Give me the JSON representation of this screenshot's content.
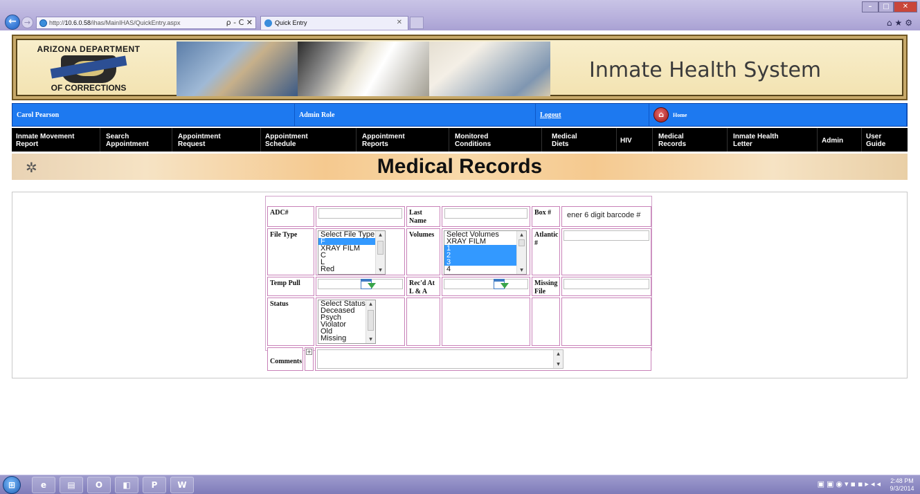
{
  "browser": {
    "address_prefix": "http://",
    "address_host": "10.6.0.58",
    "address_path": "/ihas/MainIHAS/QuickEntry.aspx",
    "address_tools": "ρ - C ✕",
    "tab_title": "Quick Entry",
    "tab_close": "✕"
  },
  "banner": {
    "logo_top": "ARIZONA DEPARTMENT",
    "logo_bottom": "OF CORRECTIONS",
    "title": "Inmate Health System"
  },
  "user_bar": {
    "user_name": "Carol Pearson",
    "role": "Admin Role",
    "logout": "Logout",
    "home": "Home"
  },
  "nav": [
    {
      "line1": "Inmate Movement",
      "line2": "Report"
    },
    {
      "line1": "Search",
      "line2": "Appointment"
    },
    {
      "line1": "Appointment",
      "line2": "Request"
    },
    {
      "line1": "Appointment",
      "line2": "Schedule"
    },
    {
      "line1": "Appointment",
      "line2": "Reports"
    },
    {
      "line1": "Monitored",
      "line2": "Conditions"
    },
    {
      "line1": "Medical",
      "line2": "Diets"
    },
    {
      "line1": "HIV",
      "line2": ""
    },
    {
      "line1": "Medical",
      "line2": "Records"
    },
    {
      "line1": "Inmate Health",
      "line2": "Letter"
    },
    {
      "line1": "Admin",
      "line2": ""
    },
    {
      "line1": "User",
      "line2": "Guide"
    }
  ],
  "page_title": "Medical Records",
  "form": {
    "adc_label": "ADC#",
    "adc_value": "",
    "last_name_label_1": "Last",
    "last_name_label_2": "Name",
    "last_name_value": "",
    "box_label": "Box #",
    "box_value": "ener 6 digit barcode #",
    "file_type_label": "File Type",
    "file_type_options": [
      {
        "text": "Select File Type",
        "selected": false
      },
      {
        "text": "F",
        "selected": true
      },
      {
        "text": "XRAY FILM",
        "selected": false
      },
      {
        "text": "C",
        "selected": false
      },
      {
        "text": "L",
        "selected": false
      },
      {
        "text": "Red",
        "selected": false
      }
    ],
    "volumes_label": "Volumes",
    "volume_options": [
      {
        "text": "Select Volumes",
        "selected": false
      },
      {
        "text": "XRAY FILM",
        "selected": false
      },
      {
        "text": "1",
        "selected": true
      },
      {
        "text": "2",
        "selected": true
      },
      {
        "text": "3",
        "selected": true
      },
      {
        "text": "4",
        "selected": false
      }
    ],
    "atlantic_label_1": "Atlantic",
    "atlantic_label_2": "#",
    "atlantic_value": "",
    "temp_pull_label": "Temp Pull",
    "temp_pull_value": "",
    "recd_label_1": "Rec'd At",
    "recd_label_2": "L & A",
    "recd_value": "",
    "missing_label_1": "Missing",
    "missing_label_2": "File",
    "missing_value": "",
    "status_label": "Status",
    "status_options": [
      {
        "text": "Select Status",
        "selected": false
      },
      {
        "text": "Deceased",
        "selected": false
      },
      {
        "text": "Psych",
        "selected": false
      },
      {
        "text": "Violator",
        "selected": false
      },
      {
        "text": "Old",
        "selected": false
      },
      {
        "text": "Missing",
        "selected": false
      }
    ],
    "comments_label": "Comments",
    "comments_toggle": "+",
    "comments_value": ""
  },
  "taskbar": {
    "clock_time": "2:48 PM",
    "clock_date": "9/3/2014"
  },
  "colors": {
    "user_bar": "#1d79f0",
    "nav_bg": "#000000",
    "form_border": "#c880b8",
    "list_selection": "#3399ff"
  }
}
